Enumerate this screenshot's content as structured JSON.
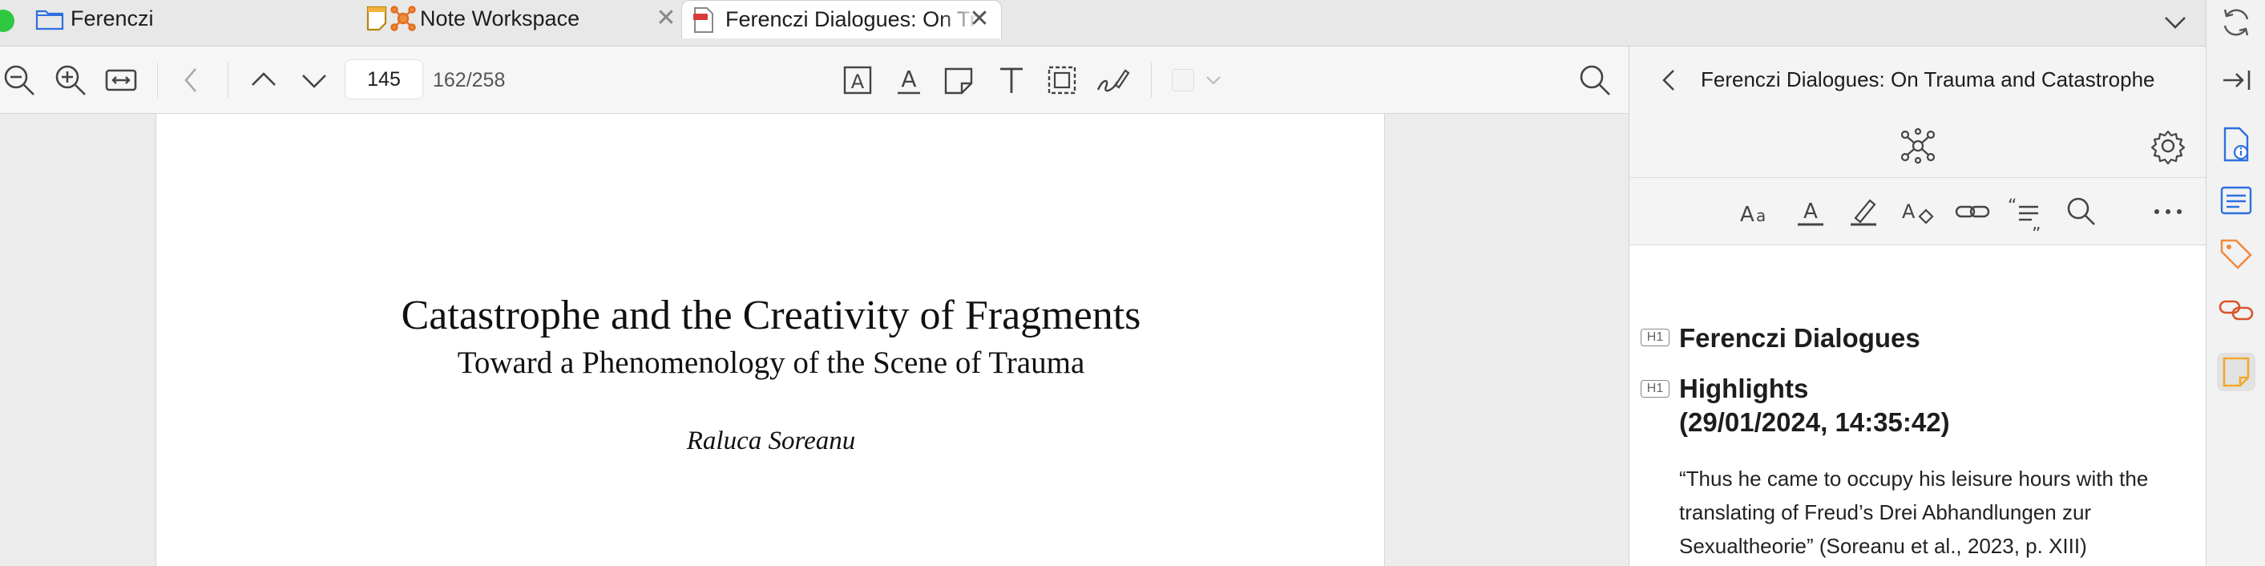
{
  "tabs": [
    {
      "label": "Ferenczi",
      "icon": "folder-icon"
    },
    {
      "label": "Note Workspace",
      "icon": "note-workspace-icon",
      "close": "✕"
    },
    {
      "label": "Ferenczi Dialogues: On Trauma and Catastrophe",
      "icon": "pdf-document-icon",
      "close": "✕",
      "active": true
    }
  ],
  "toolbar": {
    "page_number": "145",
    "page_count": "162/258"
  },
  "document": {
    "title": "Catastrophe and the Creativity of Fragments",
    "subtitle": "Toward a Phenomenology of the Scene of Trauma",
    "author": "Raluca Soreanu"
  },
  "panel": {
    "title": "Ferenczi Dialogues: On Trauma and Catastrophe",
    "note": {
      "heading_tag": "H1",
      "heading1": "Ferenczi Dialogues",
      "heading2_line1": "Highlights",
      "heading2_line2": "(29/01/2024, 14:35:42)",
      "quote": "“Thus he came to occupy his leisure hours with the translating of Freud’s Drei Abhandlungen zur Sexualtheorie” (Soreanu et al., 2023, p. XIII)"
    }
  },
  "colors": {
    "accent_blue": "#2f6fde",
    "tag_orange": "#f08a3c",
    "link_red": "#d9542a",
    "note_yellow": "#f3a92b",
    "traffic_green": "#2fc840"
  }
}
